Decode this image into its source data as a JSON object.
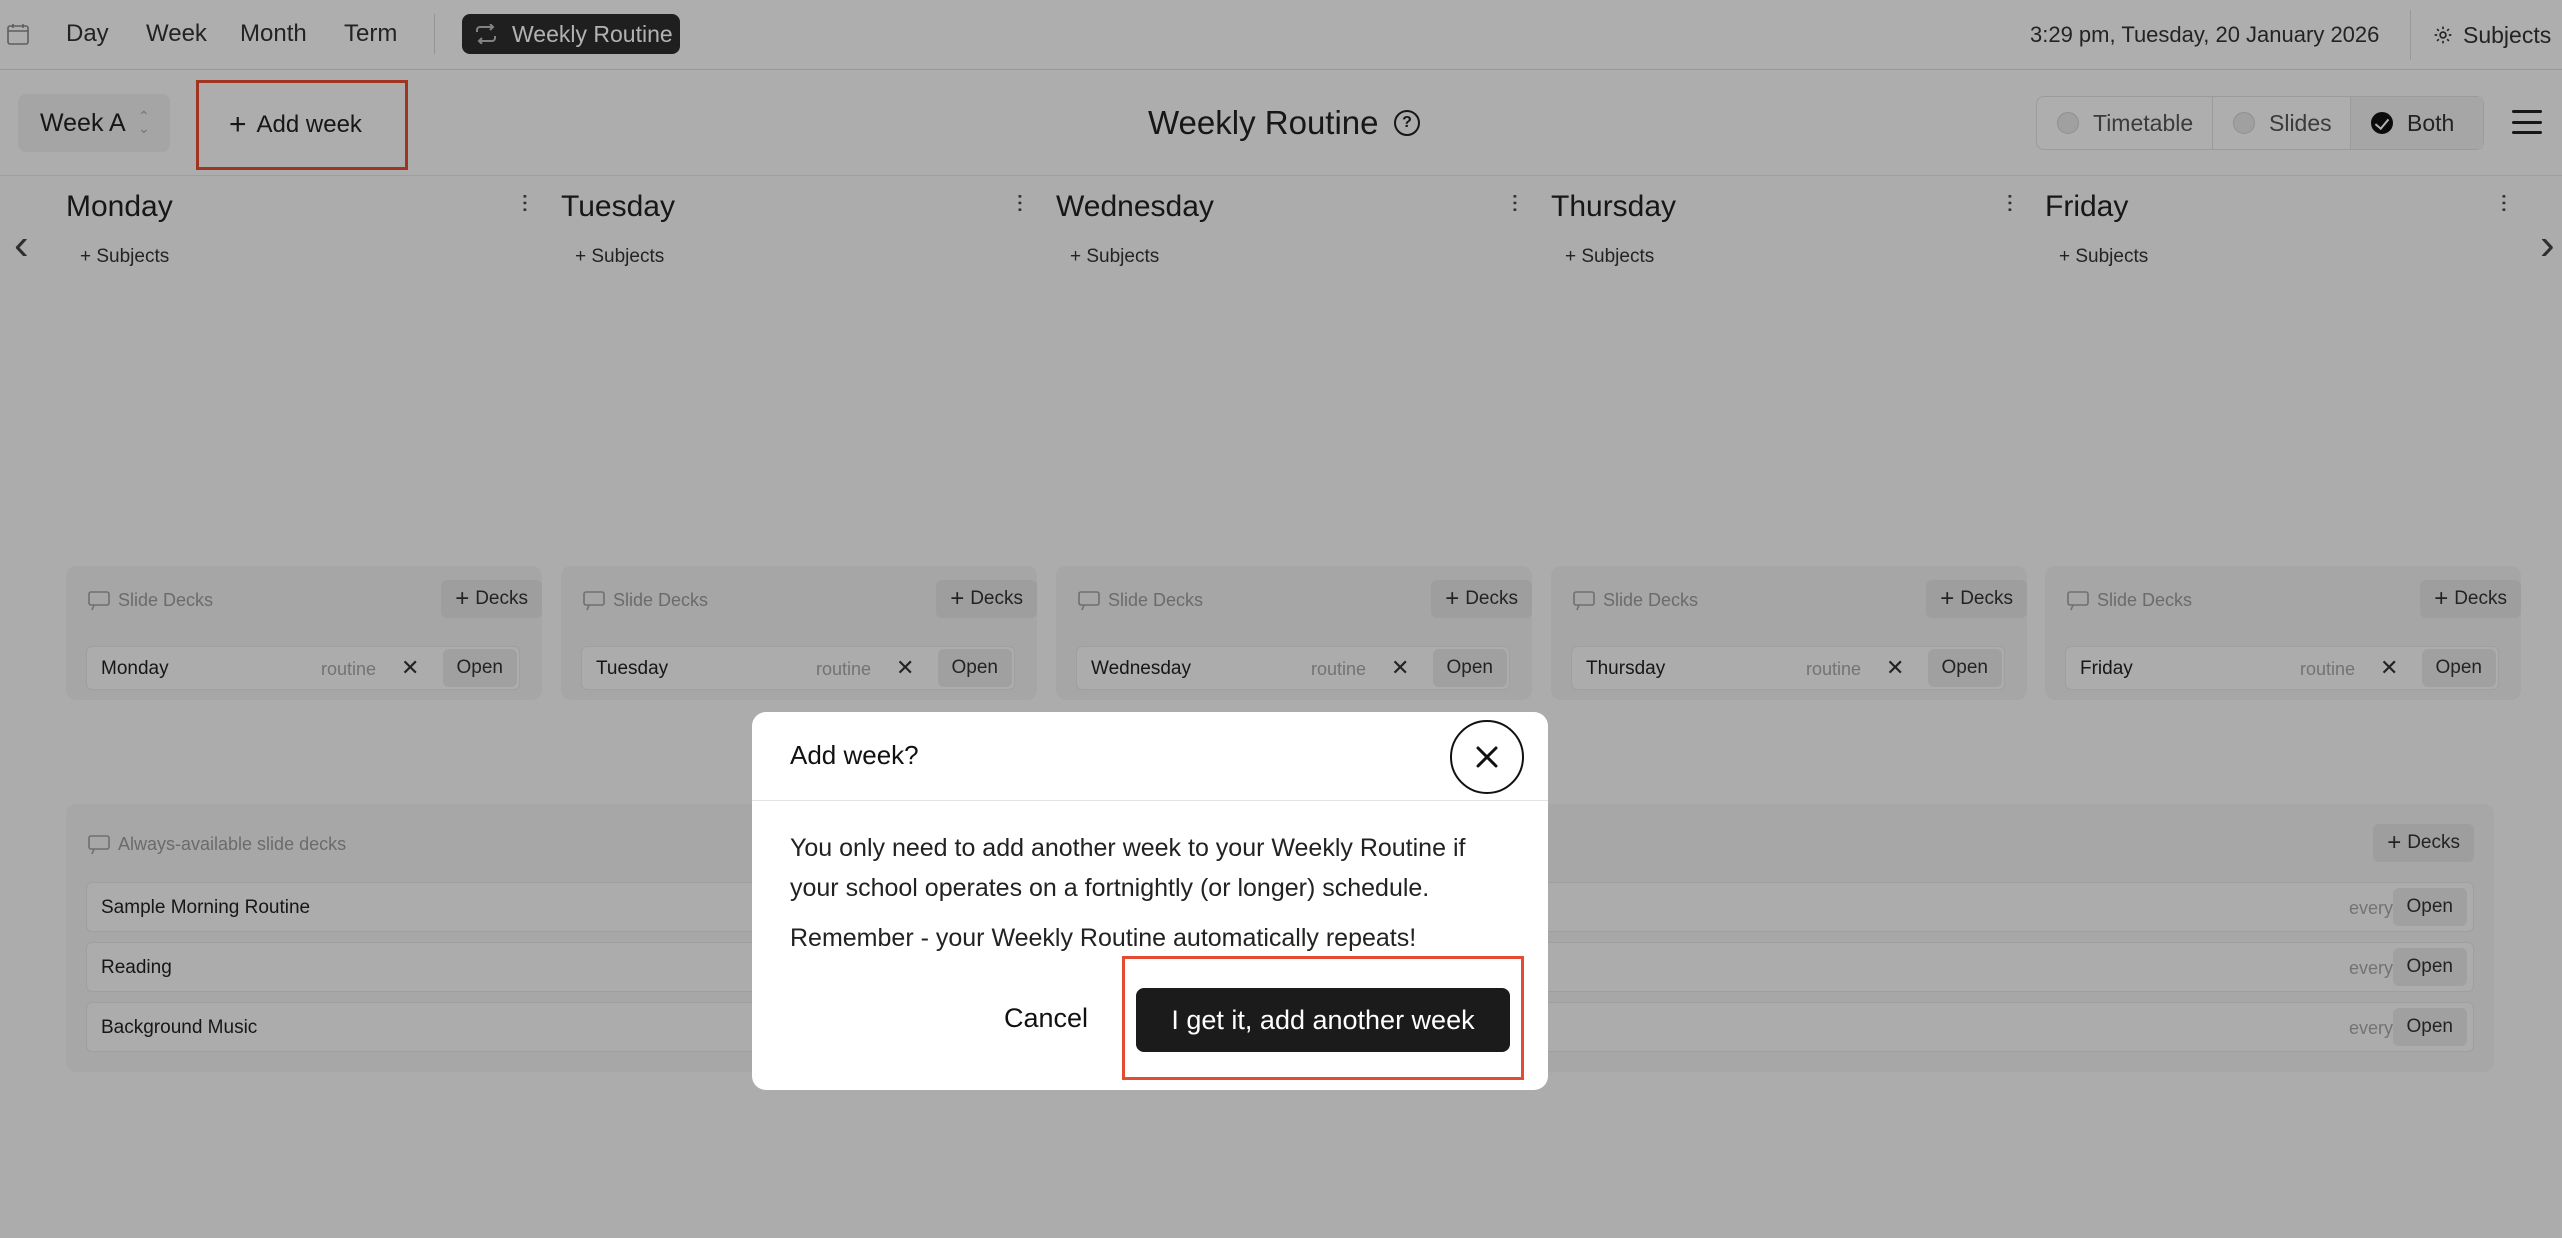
{
  "nav": {
    "links": [
      "Day",
      "Week",
      "Month",
      "Term"
    ],
    "active": "Weekly Routine",
    "datetime": "3:29 pm, Tuesday, 20 January 2026",
    "subjects": "Subjects"
  },
  "header": {
    "week_selector": "Week A",
    "add_week": "Add week",
    "title": "Weekly Routine",
    "help": "?",
    "views": [
      "Timetable",
      "Slides",
      "Both"
    ],
    "selected_view": "Both"
  },
  "days": [
    {
      "name": "Monday",
      "subjects_label": "Subjects",
      "decks_header": "Slide Decks",
      "decks_button": "Decks",
      "deck": {
        "name": "Monday",
        "tag": "routine",
        "open": "Open"
      }
    },
    {
      "name": "Tuesday",
      "subjects_label": "Subjects",
      "decks_header": "Slide Decks",
      "decks_button": "Decks",
      "deck": {
        "name": "Tuesday",
        "tag": "routine",
        "open": "Open"
      }
    },
    {
      "name": "Wednesday",
      "subjects_label": "Subjects",
      "decks_header": "Slide Decks",
      "decks_button": "Decks",
      "deck": {
        "name": "Wednesday",
        "tag": "routine",
        "open": "Open"
      }
    },
    {
      "name": "Thursday",
      "subjects_label": "Subjects",
      "decks_header": "Slide Decks",
      "decks_button": "Decks",
      "deck": {
        "name": "Thursday",
        "tag": "routine",
        "open": "Open"
      }
    },
    {
      "name": "Friday",
      "subjects_label": "Subjects",
      "decks_header": "Slide Decks",
      "decks_button": "Decks",
      "deck": {
        "name": "Friday",
        "tag": "routine",
        "open": "Open"
      }
    }
  ],
  "always": {
    "header": "Always-available slide decks",
    "decks_button": "Decks",
    "items": [
      {
        "name": "Sample Morning Routine",
        "tag": "everyday",
        "open": "Open"
      },
      {
        "name": "Reading",
        "tag": "everyday",
        "open": "Open"
      },
      {
        "name": "Background Music",
        "tag": "everyday",
        "open": "Open"
      }
    ]
  },
  "modal": {
    "title": "Add week?",
    "body": "You only need to add another week to your Weekly Routine if your school operates on a fortnightly (or longer) schedule.",
    "body2": "Remember - your Weekly Routine automatically repeats!",
    "cancel": "Cancel",
    "confirm": "I get it, add another week"
  },
  "colors": {
    "highlight": "#e54b32",
    "primary_button": "#1b1b1b"
  }
}
